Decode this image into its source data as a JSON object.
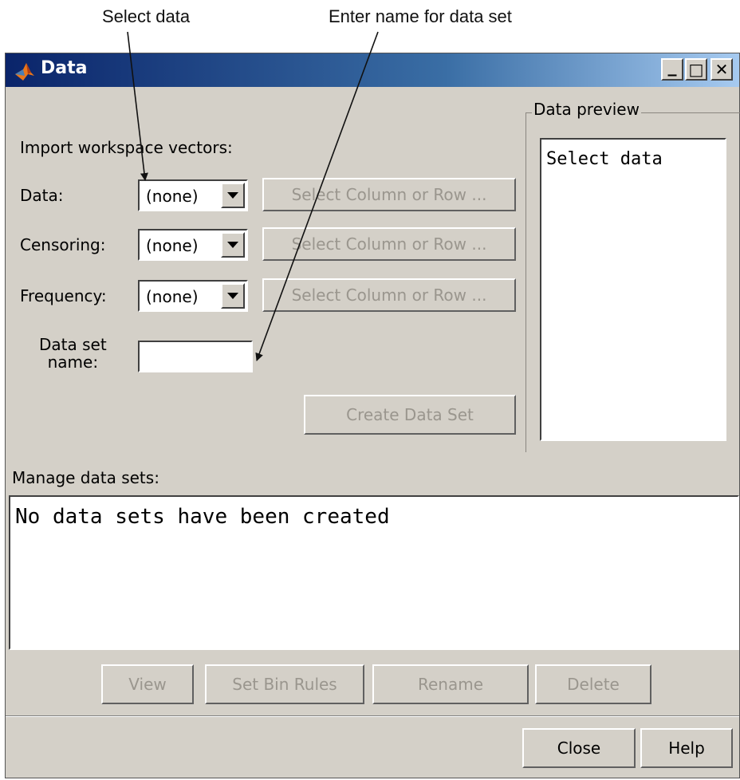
{
  "callouts": {
    "select_data": "Select data",
    "enter_name": "Enter name for data set"
  },
  "window": {
    "title": "Data",
    "controls": {
      "minimize": "_",
      "maximize": "□",
      "close": "✕"
    }
  },
  "import": {
    "heading": "Import workspace vectors:",
    "rows": [
      {
        "label": "Data:",
        "value": "(none)",
        "button": "Select Column or Row ..."
      },
      {
        "label": "Censoring:",
        "value": "(none)",
        "button": "Select Column or Row ..."
      },
      {
        "label": "Frequency:",
        "value": "(none)",
        "button": "Select Column or Row ..."
      }
    ],
    "name_label_line1": "Data set",
    "name_label_line2": "name:",
    "name_value": "",
    "create_button": "Create Data Set"
  },
  "preview": {
    "label": "Data preview",
    "text": "Select data"
  },
  "manage": {
    "heading": "Manage data sets:",
    "empty_text": "No data sets have been created",
    "buttons": {
      "view": "View",
      "bin_rules": "Set Bin Rules",
      "rename": "Rename",
      "delete": "Delete"
    }
  },
  "footer": {
    "close": "Close",
    "help": "Help"
  },
  "colors": {
    "window_bg": "#d4d0c8",
    "title_start": "#0a246a",
    "title_end": "#a6caf0",
    "disabled_text": "#9a968e"
  }
}
